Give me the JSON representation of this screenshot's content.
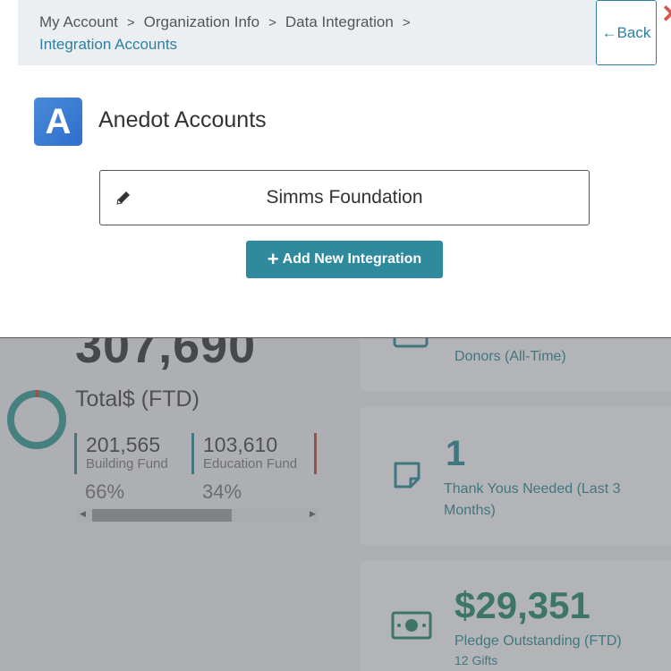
{
  "modal": {
    "breadcrumb": {
      "items": [
        "My Account",
        "Organization Info",
        "Data Integration"
      ],
      "separator": ">",
      "current": "Integration Accounts"
    },
    "back_label": "Back",
    "close_symbol": "✕",
    "logo_letter": "A",
    "title": "Anedot Accounts",
    "accounts": [
      "Simms Foundation"
    ],
    "add_button_label": "Add New Integration",
    "colors": {
      "accent": "#2e8a9c",
      "link": "#2e7fa0",
      "close": "#d9534f",
      "logo": "#3b7bd4"
    }
  },
  "dashboard": {
    "total": {
      "value": "307,690",
      "label": "Total$ (FTD)",
      "funds": [
        {
          "amount": "201,565",
          "name": "Building Fund",
          "percent": "66%",
          "color": "#1f7f86"
        },
        {
          "amount": "103,610",
          "name": "Education Fund",
          "percent": "34%",
          "color": "#1f7f86"
        },
        {
          "amount": "",
          "name": "",
          "percent": "",
          "color": "#c0392b"
        }
      ],
      "scroll_position": 0.06
    },
    "cards": [
      {
        "value": "",
        "label": "Donors (All-Time)",
        "icon": "id-card-icon"
      },
      {
        "value": "1",
        "label": "Thank Yous Needed (Last 3 Months)",
        "icon": "note-icon"
      },
      {
        "value": "$29,351",
        "label": "Pledge Outstanding (FTD)",
        "sublabel": "12 Gifts",
        "icon": "money-bill-icon"
      }
    ],
    "colors": {
      "accent": "#1f7a85",
      "money": "#1a7a5a"
    }
  }
}
